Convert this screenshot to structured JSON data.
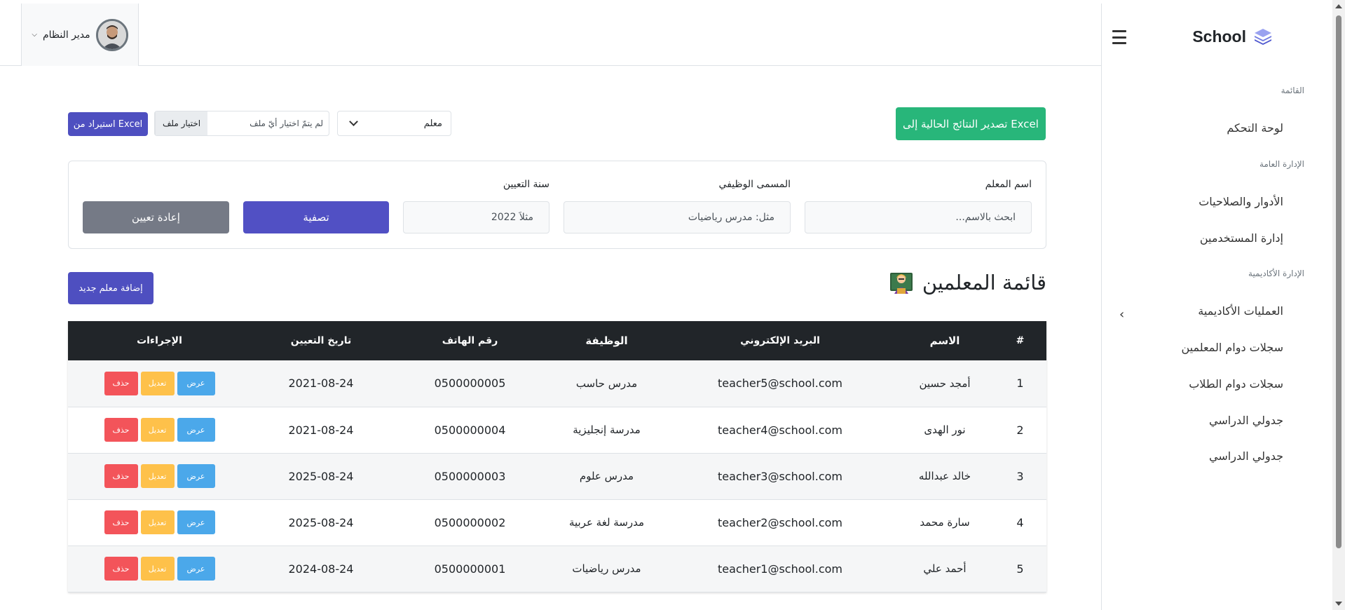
{
  "sidebar": {
    "brand": "School",
    "sections": [
      {
        "title": "القائمة"
      },
      {
        "title": "الإدارة العامة"
      },
      {
        "title": "الإدارة الأكاديمية"
      }
    ],
    "items": [
      {
        "label": "لوحة التحكم"
      },
      {
        "label": "الأدوار والصلاحيات"
      },
      {
        "label": "إدارة المستخدمين"
      },
      {
        "label": "العمليات الأكاديمية"
      },
      {
        "label": "سجلات دوام المعلمين"
      },
      {
        "label": "سجلات دوام الطلاب"
      },
      {
        "label": "جدولي الدراسي"
      },
      {
        "label": "جدولي الدراسي"
      }
    ]
  },
  "header": {
    "user_name": "مدير النظام"
  },
  "toolbar": {
    "export_label": "تصدير النتائج الحالية إلى Excel",
    "import_label": "استيراد من Excel",
    "file_button": "اختيار ملف",
    "file_status": "لم يتمّ اختيار أيّ ملف",
    "role_selected": "معلم"
  },
  "filters": {
    "name_label": "اسم المعلم",
    "name_placeholder": "ابحث بالاسم...",
    "job_label": "المسمى الوظيفي",
    "job_placeholder": "مثل: مدرس رياضيات",
    "year_label": "سنة التعيين",
    "year_placeholder": "مثلاً 2022",
    "filter_button": "تصفية",
    "reset_button": "إعادة تعيين"
  },
  "page": {
    "title": "قائمة المعلمين",
    "add_button": "إضافة معلم جديد"
  },
  "table": {
    "headers": [
      "#",
      "الاسم",
      "البريد الإلكتروني",
      "الوظيفة",
      "رقم الهاتف",
      "تاريخ التعيين",
      "الإجراءات"
    ],
    "action_labels": {
      "view": "عرض",
      "edit": "تعديل",
      "delete": "حذف"
    },
    "rows": [
      {
        "idx": "1",
        "name": "أمجد حسين",
        "email": "teacher5@school.com",
        "job": "مدرس حاسب",
        "phone": "0500000005",
        "date": "2021-08-24"
      },
      {
        "idx": "2",
        "name": "نور الهدى",
        "email": "teacher4@school.com",
        "job": "مدرسة إنجليزية",
        "phone": "0500000004",
        "date": "2021-08-24"
      },
      {
        "idx": "3",
        "name": "خالد عبدالله",
        "email": "teacher3@school.com",
        "job": "مدرس علوم",
        "phone": "0500000003",
        "date": "2025-08-24"
      },
      {
        "idx": "4",
        "name": "سارة محمد",
        "email": "teacher2@school.com",
        "job": "مدرسة لغة عربية",
        "phone": "0500000002",
        "date": "2025-08-24"
      },
      {
        "idx": "5",
        "name": "أحمد علي",
        "email": "teacher1@school.com",
        "job": "مدرس رياضيات",
        "phone": "0500000001",
        "date": "2024-08-24"
      }
    ]
  },
  "colors": {
    "primary": "#5150c4",
    "success": "#28b67a",
    "secondary": "#757a86",
    "info": "#4ba8ea",
    "warning": "#fec14a",
    "danger": "#f3545a",
    "dark": "#212529"
  }
}
